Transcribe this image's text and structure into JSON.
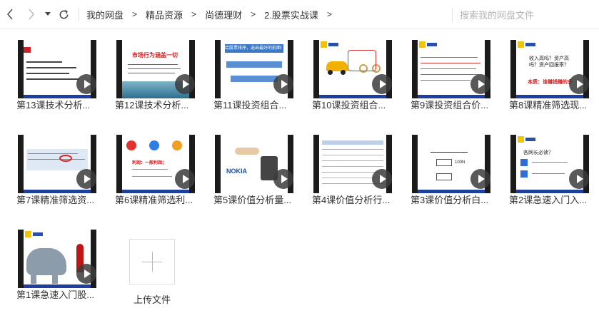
{
  "nav": {
    "back_icon": "chevron-left-icon",
    "forward_icon": "chevron-right-icon",
    "dropdown_icon": "caret-down-icon",
    "refresh_icon": "refresh-icon"
  },
  "breadcrumb": [
    {
      "label": "我的网盘"
    },
    {
      "label": "精品资源"
    },
    {
      "label": "尚德理财"
    },
    {
      "label": "2.股票实战课"
    }
  ],
  "breadcrumb_separator": ">",
  "search": {
    "placeholder": "搜索我的网盘文件"
  },
  "files": [
    {
      "label": "第13课技术分析...",
      "type": "video"
    },
    {
      "label": "第12课技术分析...",
      "type": "video"
    },
    {
      "label": "第11课投资组合...",
      "type": "video"
    },
    {
      "label": "第10课投资组合...",
      "type": "video"
    },
    {
      "label": "第9课投资组合价...",
      "type": "video"
    },
    {
      "label": "第8课精准筛选现...",
      "type": "video"
    },
    {
      "label": "第7课精准筛选资...",
      "type": "video"
    },
    {
      "label": "第6课精准筛选利...",
      "type": "video"
    },
    {
      "label": "第5课价值分析量...",
      "type": "video"
    },
    {
      "label": "第4课价值分析行...",
      "type": "video"
    },
    {
      "label": "第3课价值分析白...",
      "type": "video"
    },
    {
      "label": "第2课急速入门入...",
      "type": "video"
    },
    {
      "label": "第1课急速入门股...",
      "type": "video"
    }
  ],
  "upload": {
    "label": "上传文件"
  },
  "thumb_text": {
    "t12_title": "市场行为涵盖一切",
    "t11_head": "给股票排序，选出最好的前面!",
    "t8_q": "收入高吗？资产高吗？资产回报率？",
    "t8_red": "本质：谁赚钱赚的多",
    "t6_a": "利润：一般利润；",
    "t5_logo": "NOKIA",
    "t3_num": "100N",
    "t2_q": "各网长必读？"
  },
  "colors": {
    "accent": "#1f3f9f",
    "text": "#333333",
    "divider": "#ececec"
  }
}
